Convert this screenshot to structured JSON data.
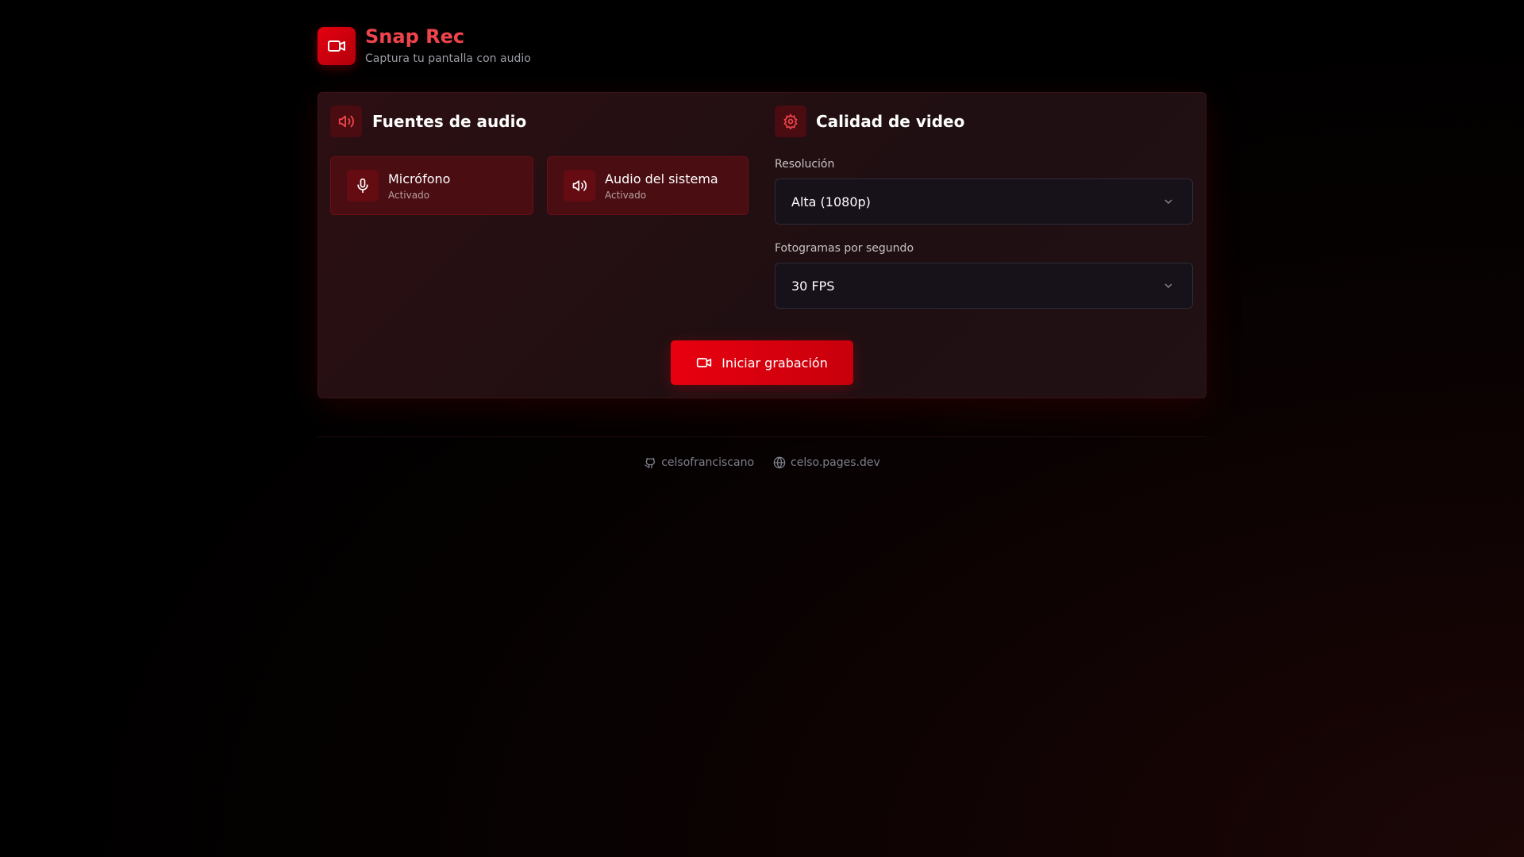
{
  "header": {
    "title": "Snap Rec",
    "subtitle": "Captura tu pantalla con audio"
  },
  "audio": {
    "title": "Fuentes de audio",
    "sources": [
      {
        "label": "Micrófono",
        "status": "Activado"
      },
      {
        "label": "Audio del sistema",
        "status": "Activado"
      }
    ]
  },
  "video": {
    "title": "Calidad de video",
    "resolution_label": "Resolución",
    "resolution_value": "Alta (1080p)",
    "fps_label": "Fotogramas por segundo",
    "fps_value": "30 FPS"
  },
  "record_button": "Iniciar grabación",
  "footer": {
    "github": "celsofranciscano",
    "website": "celso.pages.dev"
  },
  "colors": {
    "accent": "#e5000f",
    "title": "#f0444c"
  }
}
